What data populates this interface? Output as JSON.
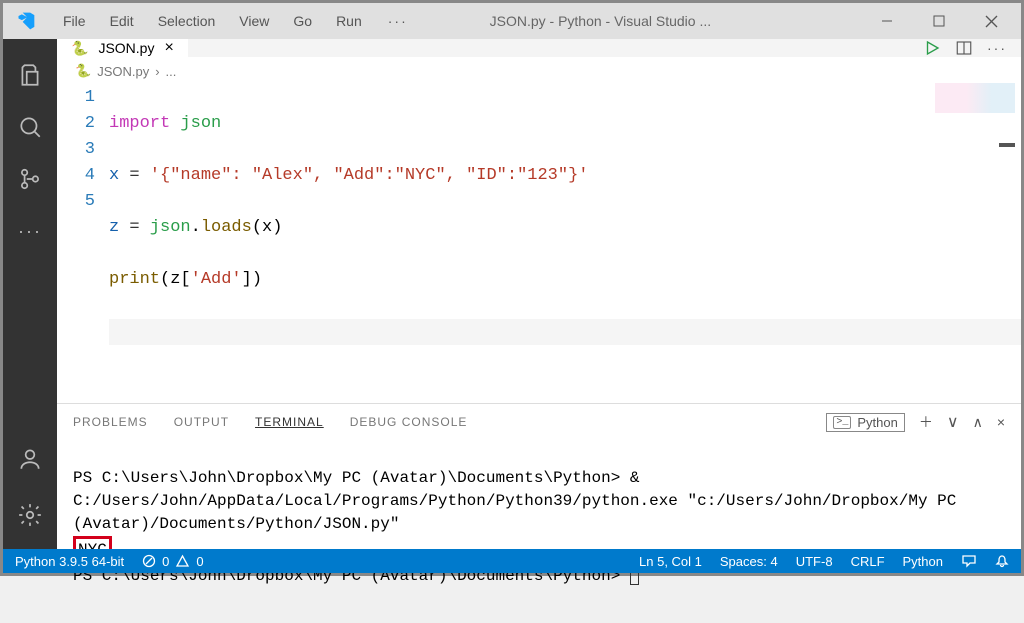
{
  "menu": {
    "file": "File",
    "edit": "Edit",
    "selection": "Selection",
    "view": "View",
    "go": "Go",
    "run": "Run"
  },
  "title": "JSON.py - Python - Visual Studio ...",
  "tabs": [
    {
      "label": "JSON.py"
    }
  ],
  "breadcrumb": {
    "file": "JSON.py",
    "sep": "›",
    "rest": "..."
  },
  "code": {
    "l1a": "import",
    "l1b": "json",
    "l2a": "x ",
    "l2op": "=",
    "l2b": " '{\"name\": \"Alex\", \"Add\":\"NYC\", \"ID\":\"123\"}'",
    "l3a": "z ",
    "l3op": "=",
    "l3b": " json",
    "l3dot": ".",
    "l3fn": "loads",
    "l3par": "(x)",
    "l4fn": "print",
    "l4par1": "(z[",
    "l4str": "'Add'",
    "l4par2": "])"
  },
  "panel": {
    "tabs": {
      "problems": "PROBLEMS",
      "output": "OUTPUT",
      "terminal": "TERMINAL",
      "debug": "DEBUG CONSOLE"
    },
    "termLabel": "Python"
  },
  "terminal": {
    "line1": "PS C:\\Users\\John\\Dropbox\\My PC (Avatar)\\Documents\\Python> & C:/Users/John/AppData/Local/Programs/Python/Python39/python.exe \"c:/Users/John/Dropbox/My PC (Avatar)/Documents/Python/JSON.py\"",
    "output": "NYC",
    "line2": "PS C:\\Users\\John\\Dropbox\\My PC (Avatar)\\Documents\\Python> "
  },
  "status": {
    "python": "Python 3.9.5 64-bit",
    "errors": "0",
    "warnings": "0",
    "pos": "Ln 5, Col 1",
    "spaces": "Spaces: 4",
    "enc": "UTF-8",
    "eol": "CRLF",
    "lang": "Python"
  }
}
